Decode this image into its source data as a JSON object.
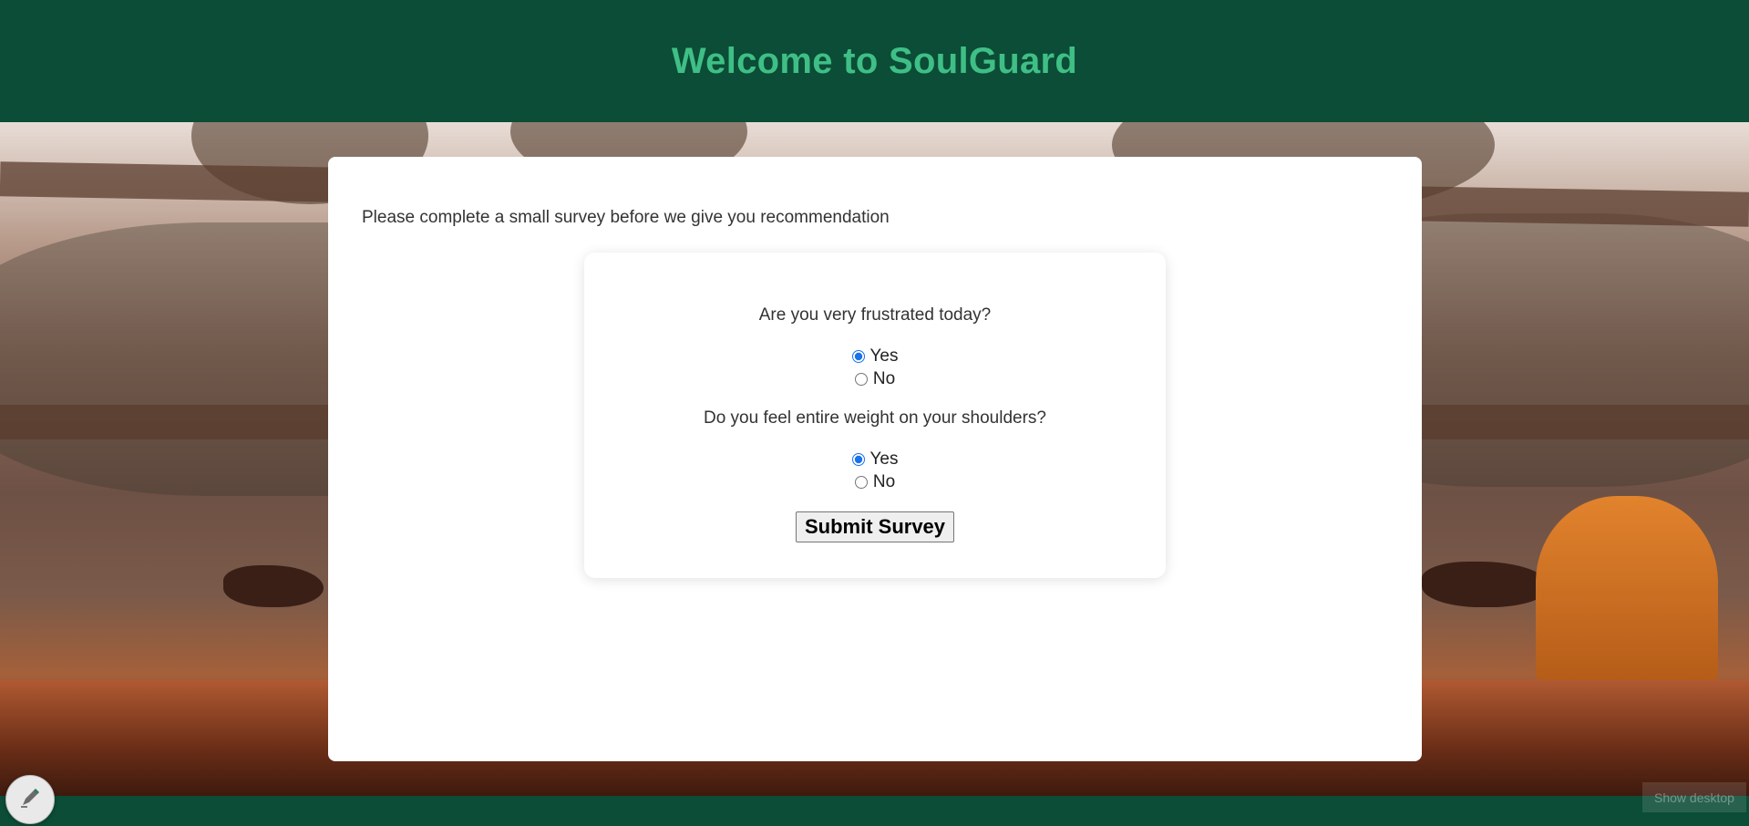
{
  "header": {
    "title": "Welcome to SoulGuard"
  },
  "survey": {
    "intro": "Please complete a small survey before we give you recommendation",
    "questions": [
      {
        "text": "Are you very frustrated today?",
        "options": [
          "Yes",
          "No"
        ],
        "selected": "Yes"
      },
      {
        "text": "Do you feel entire weight on your shoulders?",
        "options": [
          "Yes",
          "No"
        ],
        "selected": "Yes"
      }
    ],
    "submit_label": "Submit Survey"
  },
  "taskbar": {
    "show_desktop": "Show desktop",
    "pen_icon": "pen-icon"
  },
  "colors": {
    "header_bg": "#0b4d36",
    "title": "#3fbf86",
    "radio_accent": "#1a73e8"
  }
}
